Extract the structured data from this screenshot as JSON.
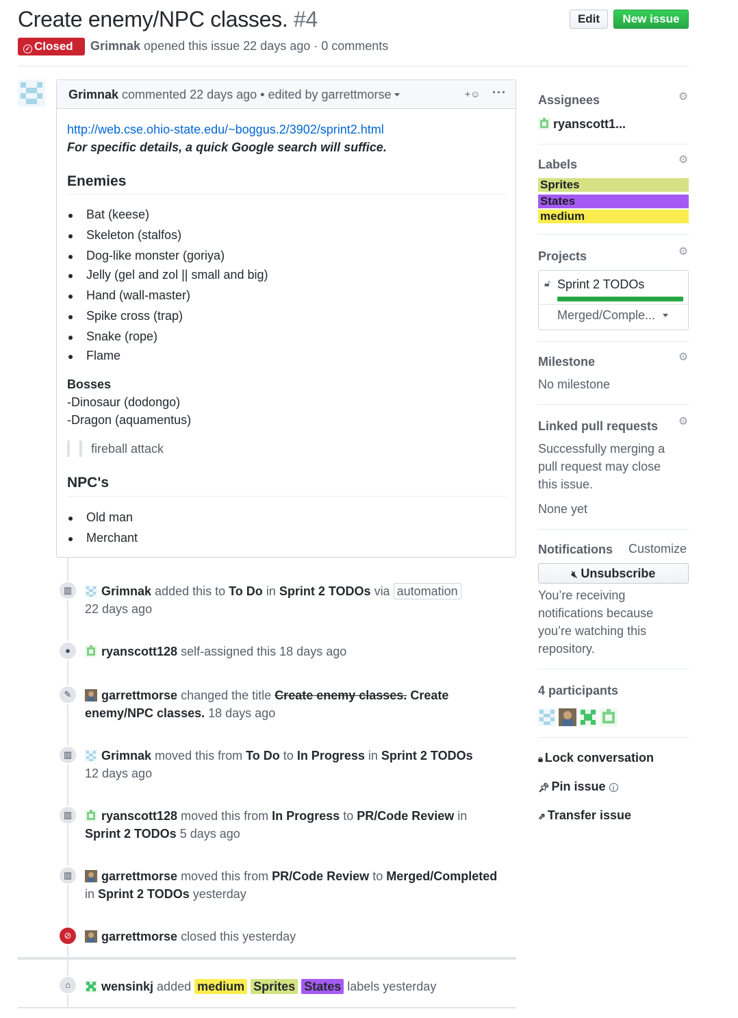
{
  "header": {
    "title": "Create enemy/NPC classes.",
    "number": "#4",
    "edit_label": "Edit",
    "new_issue_label": "New issue",
    "state_label": "Closed",
    "author": "Grimnak",
    "meta_rest": "opened this issue 22 days ago · 0 comments"
  },
  "comment": {
    "author": "Grimnak",
    "meta": "commented 22 days ago • edited by garrettmorse",
    "react_icon": "smiley-icon",
    "more_icon": "kebab-icon",
    "link": "http://web.cse.ohio-state.edu/~boggus.2/3902/sprint2.html",
    "note": "For specific details, a quick Google search will suffice.",
    "enemies_heading": "Enemies",
    "enemies": [
      "Bat (keese)",
      "Skeleton (stalfos)",
      "Dog-like monster (goriya)",
      "Jelly (gel and zol || small and big)",
      "Hand (wall-master)",
      "Spike cross (trap)",
      "Snake (rope)",
      "Flame"
    ],
    "bosses_heading": "Bosses",
    "bosses": [
      "-Dinosaur (dodongo)",
      "-Dragon (aquamentus)"
    ],
    "quote": "fireball attack",
    "npcs_heading": "NPC's",
    "npcs": [
      "Old man",
      "Merchant"
    ]
  },
  "timeline": {
    "e1": {
      "actor": "Grimnak",
      "t1": "added this to",
      "col": "To Do",
      "t2": "in",
      "proj": "Sprint 2 TODOs",
      "t3": "via",
      "via": "automation",
      "time": "22 days ago"
    },
    "e2": {
      "actor": "ryanscott128",
      "t1": "self-assigned this 18 days ago"
    },
    "e3": {
      "actor": "garrettmorse",
      "t1": "changed the title",
      "old": "Create enemy classes.",
      "new_a": "Create",
      "new_b": "enemy/NPC classes.",
      "time": "18 days ago"
    },
    "e4": {
      "actor": "Grimnak",
      "t1": "moved this from",
      "from": "To Do",
      "t2": "to",
      "to": "In Progress",
      "t3": "in",
      "proj": "Sprint 2 TODOs",
      "time": "12 days ago"
    },
    "e5": {
      "actor": "ryanscott128",
      "t1": "moved this from",
      "from": "In Progress",
      "t2": "to",
      "to": "PR/Code Review",
      "t3": "in",
      "proj": "Sprint 2 TODOs",
      "time": "5 days ago"
    },
    "e6": {
      "actor": "garrettmorse",
      "t1": "moved this from",
      "from": "PR/Code Review",
      "t2": "to",
      "to": "Merged/Completed",
      "t3": "in",
      "proj": "Sprint 2 TODOs",
      "time": "yesterday"
    },
    "e7": {
      "actor": "garrettmorse",
      "t1": "closed this yesterday"
    },
    "e8": {
      "actor": "wensinkj",
      "t1": "added",
      "l1": "medium",
      "l2": "Sprites",
      "l3": "States",
      "t2": "labels yesterday"
    }
  },
  "sidebar": {
    "assignees": {
      "heading": "Assignees",
      "user": "ryanscott1..."
    },
    "labels": {
      "heading": "Labels",
      "items": [
        {
          "name": "Sprites",
          "color": "#d4e283"
        },
        {
          "name": "States",
          "color": "#a55af4"
        },
        {
          "name": "medium",
          "color": "#fbed50"
        }
      ]
    },
    "projects": {
      "heading": "Projects",
      "name": "Sprint 2 TODOs",
      "column": "Merged/Comple...",
      "progress": 1.0
    },
    "milestone": {
      "heading": "Milestone",
      "value": "No milestone"
    },
    "linked_prs": {
      "heading": "Linked pull requests",
      "l1": "Successfully merging a",
      "l2": "pull request may close",
      "l3": "this issue.",
      "none": "None yet"
    },
    "notifications": {
      "heading": "Notifications",
      "customize": "Customize",
      "unsubscribe": "Unsubscribe",
      "l1": "You’re receiving",
      "l2": "notifications because",
      "l3": "you’re watching this",
      "l4": "repository."
    },
    "participants": {
      "heading": "4 participants"
    },
    "actions": {
      "lock": "Lock conversation",
      "pin": "Pin issue",
      "transfer": "Transfer issue"
    }
  },
  "colors": {
    "closed": "#cb2431",
    "green": "#28a745",
    "link": "#0366d6"
  }
}
